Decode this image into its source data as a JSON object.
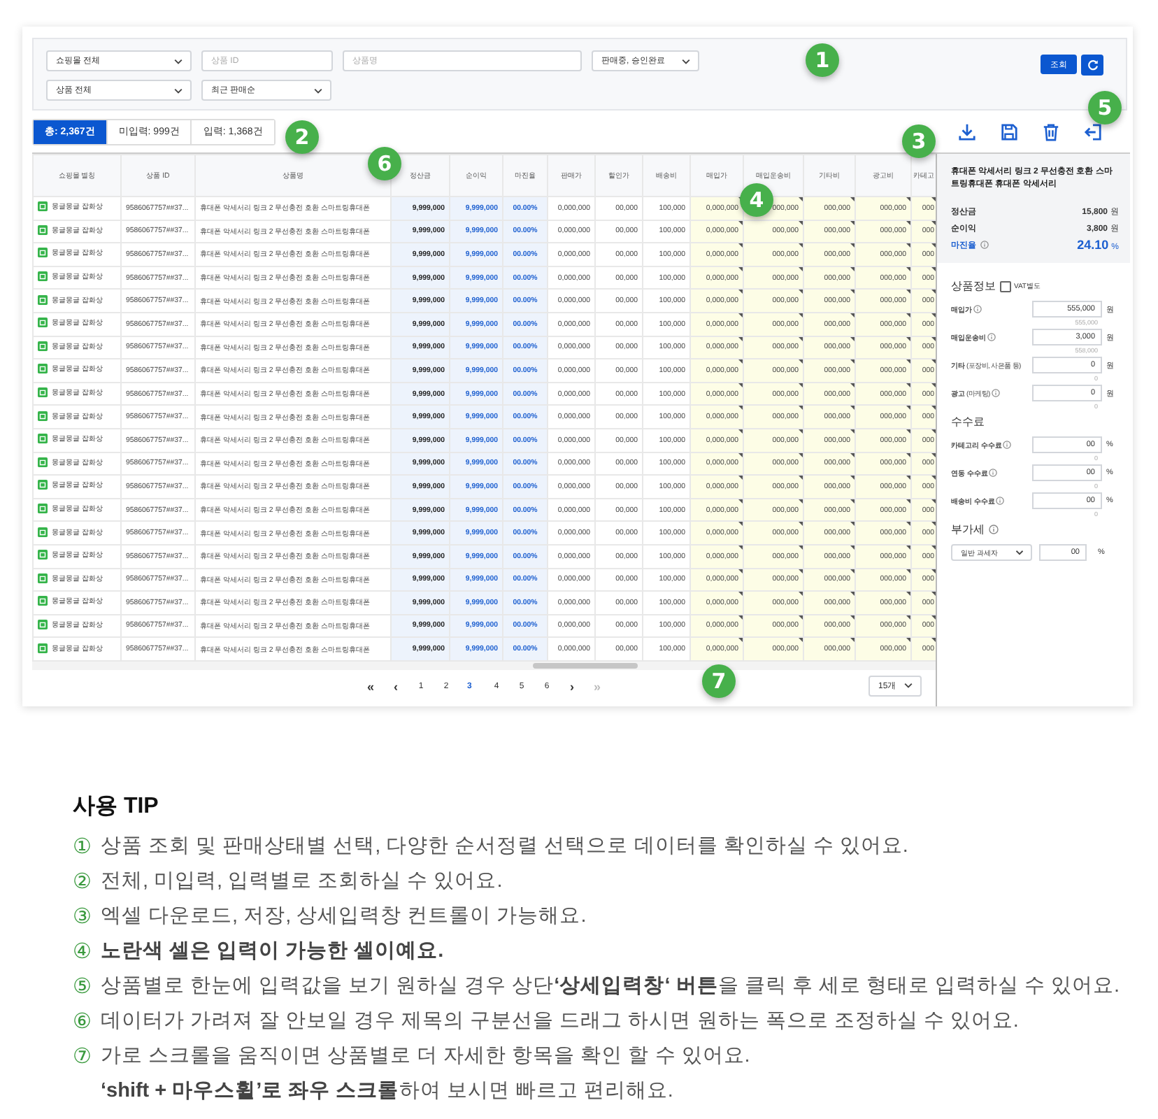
{
  "filters": {
    "row1": [
      {
        "kind": "select",
        "value": "쇼핑몰 전체"
      },
      {
        "kind": "input",
        "placeholder": "상품 ID"
      },
      {
        "kind": "input",
        "placeholder": "상품명"
      },
      {
        "kind": "select",
        "value": "판매중, 승인완료"
      }
    ],
    "row2": [
      {
        "kind": "select",
        "value": "상품 전체"
      },
      {
        "kind": "select",
        "value": "최근 판매순"
      }
    ],
    "search_button": "조회"
  },
  "tabs": [
    {
      "label": "총: 2,367건",
      "selected": true
    },
    {
      "label": "미입력: 999건",
      "selected": false
    },
    {
      "label": "입력: 1,368건",
      "selected": false
    }
  ],
  "table": {
    "columns": [
      {
        "label": "쇼핑몰 별칭",
        "kind": "store"
      },
      {
        "label": "상품 ID",
        "kind": "id"
      },
      {
        "label": "상품명",
        "kind": "name"
      },
      {
        "label": "정산금",
        "kind": "settle"
      },
      {
        "label": "순이익",
        "kind": "profit"
      },
      {
        "label": "마진율",
        "kind": "margin"
      },
      {
        "label": "판매가",
        "kind": "plain"
      },
      {
        "label": "할인가",
        "kind": "plain"
      },
      {
        "label": "배송비",
        "kind": "plain"
      },
      {
        "label": "매입가",
        "kind": "input"
      },
      {
        "label": "매입운송비",
        "kind": "input"
      },
      {
        "label": "기타비",
        "kind": "input"
      },
      {
        "label": "광고비",
        "kind": "input"
      },
      {
        "label": "카테고",
        "kind": "input"
      }
    ],
    "rows": [
      [
        "몽글몽글 잡화상",
        "9586067757##37...",
        "휴대폰 악세서리 링크 2 무선충전 호환 스마트링휴대폰",
        "9,999,000",
        "9,999,000",
        "00.00%",
        "0,000,000",
        "00,000",
        "100,000",
        "0,000,000",
        "000,000",
        "000,000",
        "000,000",
        "000"
      ],
      [
        "몽글몽글 잡화상",
        "9586067757##37...",
        "휴대폰 악세서리 링크 2 무선충전 호환 스마트링휴대폰",
        "9,999,000",
        "9,999,000",
        "00.00%",
        "0,000,000",
        "00,000",
        "100,000",
        "0,000,000",
        "000,000",
        "000,000",
        "000,000",
        "000"
      ],
      [
        "몽글몽글 잡화상",
        "9586067757##37...",
        "휴대폰 악세서리 링크 2 무선충전 호환 스마트링휴대폰",
        "9,999,000",
        "9,999,000",
        "00.00%",
        "0,000,000",
        "00,000",
        "100,000",
        "0,000,000",
        "000,000",
        "000,000",
        "000,000",
        "000"
      ],
      [
        "몽글몽글 잡화상",
        "9586067757##37...",
        "휴대폰 악세서리 링크 2 무선충전 호환 스마트링휴대폰",
        "9,999,000",
        "9,999,000",
        "00.00%",
        "0,000,000",
        "00,000",
        "100,000",
        "0,000,000",
        "000,000",
        "000,000",
        "000,000",
        "000"
      ],
      [
        "몽글몽글 잡화상",
        "9586067757##37...",
        "휴대폰 악세서리 링크 2 무선충전 호환 스마트링휴대폰",
        "9,999,000",
        "9,999,000",
        "00.00%",
        "0,000,000",
        "00,000",
        "100,000",
        "0,000,000",
        "000,000",
        "000,000",
        "000,000",
        "000"
      ],
      [
        "몽글몽글 잡화상",
        "9586067757##37...",
        "휴대폰 악세서리 링크 2 무선충전 호환 스마트링휴대폰",
        "9,999,000",
        "9,999,000",
        "00.00%",
        "0,000,000",
        "00,000",
        "100,000",
        "0,000,000",
        "000,000",
        "000,000",
        "000,000",
        "000"
      ],
      [
        "몽글몽글 잡화상",
        "9586067757##37...",
        "휴대폰 악세서리 링크 2 무선충전 호환 스마트링휴대폰",
        "9,999,000",
        "9,999,000",
        "00.00%",
        "0,000,000",
        "00,000",
        "100,000",
        "0,000,000",
        "000,000",
        "000,000",
        "000,000",
        "000"
      ],
      [
        "몽글몽글 잡화상",
        "9586067757##37...",
        "휴대폰 악세서리 링크 2 무선충전 호환 스마트링휴대폰",
        "9,999,000",
        "9,999,000",
        "00.00%",
        "0,000,000",
        "00,000",
        "100,000",
        "0,000,000",
        "000,000",
        "000,000",
        "000,000",
        "000"
      ],
      [
        "몽글몽글 잡화상",
        "9586067757##37...",
        "휴대폰 악세서리 링크 2 무선충전 호환 스마트링휴대폰",
        "9,999,000",
        "9,999,000",
        "00.00%",
        "0,000,000",
        "00,000",
        "100,000",
        "0,000,000",
        "000,000",
        "000,000",
        "000,000",
        "000"
      ],
      [
        "몽글몽글 잡화상",
        "9586067757##37...",
        "휴대폰 악세서리 링크 2 무선충전 호환 스마트링휴대폰",
        "9,999,000",
        "9,999,000",
        "00.00%",
        "0,000,000",
        "00,000",
        "100,000",
        "0,000,000",
        "000,000",
        "000,000",
        "000,000",
        "000"
      ],
      [
        "몽글몽글 잡화상",
        "9586067757##37...",
        "휴대폰 악세서리 링크 2 무선충전 호환 스마트링휴대폰",
        "9,999,000",
        "9,999,000",
        "00.00%",
        "0,000,000",
        "00,000",
        "100,000",
        "0,000,000",
        "000,000",
        "000,000",
        "000,000",
        "000"
      ],
      [
        "몽글몽글 잡화상",
        "9586067757##37...",
        "휴대폰 악세서리 링크 2 무선충전 호환 스마트링휴대폰",
        "9,999,000",
        "9,999,000",
        "00.00%",
        "0,000,000",
        "00,000",
        "100,000",
        "0,000,000",
        "000,000",
        "000,000",
        "000,000",
        "000"
      ],
      [
        "몽글몽글 잡화상",
        "9586067757##37...",
        "휴대폰 악세서리 링크 2 무선충전 호환 스마트링휴대폰",
        "9,999,000",
        "9,999,000",
        "00.00%",
        "0,000,000",
        "00,000",
        "100,000",
        "0,000,000",
        "000,000",
        "000,000",
        "000,000",
        "000"
      ],
      [
        "몽글몽글 잡화상",
        "9586067757##37...",
        "휴대폰 악세서리 링크 2 무선충전 호환 스마트링휴대폰",
        "9,999,000",
        "9,999,000",
        "00.00%",
        "0,000,000",
        "00,000",
        "100,000",
        "0,000,000",
        "000,000",
        "000,000",
        "000,000",
        "000"
      ],
      [
        "몽글몽글 잡화상",
        "9586067757##37...",
        "휴대폰 악세서리 링크 2 무선충전 호환 스마트링휴대폰",
        "9,999,000",
        "9,999,000",
        "00.00%",
        "0,000,000",
        "00,000",
        "100,000",
        "0,000,000",
        "000,000",
        "000,000",
        "000,000",
        "000"
      ],
      [
        "몽글몽글 잡화상",
        "9586067757##37...",
        "휴대폰 악세서리 링크 2 무선충전 호환 스마트링휴대폰",
        "9,999,000",
        "9,999,000",
        "00.00%",
        "0,000,000",
        "00,000",
        "100,000",
        "0,000,000",
        "000,000",
        "000,000",
        "000,000",
        "000"
      ],
      [
        "몽글몽글 잡화상",
        "9586067757##37...",
        "휴대폰 악세서리 링크 2 무선충전 호환 스마트링휴대폰",
        "9,999,000",
        "9,999,000",
        "00.00%",
        "0,000,000",
        "00,000",
        "100,000",
        "0,000,000",
        "000,000",
        "000,000",
        "000,000",
        "000"
      ],
      [
        "몽글몽글 잡화상",
        "9586067757##37...",
        "휴대폰 악세서리 링크 2 무선충전 호환 스마트링휴대폰",
        "9,999,000",
        "9,999,000",
        "00.00%",
        "0,000,000",
        "00,000",
        "100,000",
        "0,000,000",
        "000,000",
        "000,000",
        "000,000",
        "000"
      ],
      [
        "몽글몽글 잡화상",
        "9586067757##37...",
        "휴대폰 악세서리 링크 2 무선충전 호환 스마트링휴대폰",
        "9,999,000",
        "9,999,000",
        "00.00%",
        "0,000,000",
        "00,000",
        "100,000",
        "0,000,000",
        "000,000",
        "000,000",
        "000,000",
        "000"
      ],
      [
        "몽글몽글 잡화상",
        "9586067757##37...",
        "휴대폰 악세서리 링크 2 무선충전 호환 스마트링휴대폰",
        "9,999,000",
        "9,999,000",
        "00.00%",
        "0,000,000",
        "00,000",
        "100,000",
        "0,000,000",
        "000,000",
        "000,000",
        "000,000",
        "000"
      ]
    ]
  },
  "pagination": {
    "nav": [
      {
        "label": "«",
        "disabled": false
      },
      {
        "label": "‹",
        "disabled": false
      },
      {
        "label": "›",
        "disabled": false
      },
      {
        "label": "»",
        "disabled": true
      }
    ],
    "pages": [
      {
        "label": "1",
        "selected": false
      },
      {
        "label": "2",
        "selected": false
      },
      {
        "label": "3",
        "selected": true
      },
      {
        "label": "4",
        "selected": false
      },
      {
        "label": "5",
        "selected": false
      },
      {
        "label": "6",
        "selected": false
      }
    ],
    "page_size": "15개"
  },
  "side_panel": {
    "title": "휴대폰 악세서리 링크 2 무선충전 호환 스마트링휴대폰 휴대폰 악세서리",
    "summary": [
      {
        "label": "정산금",
        "info": false,
        "kind": "plain",
        "value": "15,800",
        "unit": "원"
      },
      {
        "label": "순이익",
        "info": false,
        "kind": "plain",
        "value": "3,800",
        "unit": "원"
      },
      {
        "label": "마진율",
        "info": true,
        "kind": "highlight",
        "value": "24.10",
        "unit": "%"
      }
    ],
    "sections": [
      {
        "heading": "상품정보",
        "info": false,
        "checkbox": {
          "label": "VAT별도",
          "checked": false
        },
        "fields": [
          {
            "kind": "input",
            "label": "매입가",
            "info": true,
            "value": "555,000",
            "unit": "원",
            "sub": "555,000"
          },
          {
            "kind": "input",
            "label": "매입운송비",
            "info": true,
            "value": "3,000",
            "unit": "원",
            "sub": "558,000"
          },
          {
            "kind": "input",
            "label": "기타",
            "note": "(포장비, 사은품 등)",
            "info": false,
            "value": "0",
            "unit": "원",
            "sub": "0"
          },
          {
            "kind": "input",
            "label": "광고",
            "note": "(마케팅)",
            "info": true,
            "value": "0",
            "unit": "원",
            "sub": "0"
          }
        ]
      },
      {
        "heading": "수수료",
        "info": false,
        "fields": [
          {
            "kind": "input",
            "label": "카테고리 수수료",
            "info": true,
            "value": "00",
            "unit": "%",
            "sub": "0"
          },
          {
            "kind": "input",
            "label": "연동 수수료",
            "info": true,
            "value": "00",
            "unit": "%",
            "sub": "0"
          },
          {
            "kind": "input",
            "label": "배송비 수수료",
            "info": true,
            "value": "00",
            "unit": "%",
            "sub": "0"
          }
        ]
      },
      {
        "heading": "부가세",
        "info": true,
        "fields": [
          {
            "kind": "select",
            "select": "일반 과세자",
            "value": "00",
            "unit": "%"
          }
        ]
      }
    ]
  },
  "callouts": [
    "1",
    "2",
    "3",
    "4",
    "5",
    "6",
    "7"
  ],
  "tips": {
    "heading": "사용 TIP",
    "items": [
      {
        "number": "①",
        "text": "상품 조회 및 판매상태별 선택, 다양한 순서정렬 선택으로 데이터를 확인하실 수 있어요."
      },
      {
        "number": "②",
        "text": "전체, 미입력, 입력별로 조회하실 수 있어요."
      },
      {
        "number": "③",
        "text": "엑셀 다운로드, 저장, 상세입력창 컨트롤이 가능해요."
      },
      {
        "number": "④",
        "text": "**노란색 셀은 입력이 가능한 셀이예요.**"
      },
      {
        "number": "⑤",
        "text": "상품별로 한눈에 입력값을 보기 원하실 경우 상단**‘상세입력창‘ 버튼**을 클릭 후 세로 형태로 입력하실 수 있어요."
      },
      {
        "number": "⑥",
        "text": "데이터가 가려져 잘 안보일 경우 제목의 구분선을 드래그 하시면 원하는 폭으로 조정하실 수 있어요."
      },
      {
        "number": "⑦",
        "text": "가로 스크롤을 움직이면 상품별로 더 자세한 항목을 확인 할 수 있어요.",
        "continuation": "**‘shift + 마우스휠’로 좌우 스크롤**하여 보시면 빠르고 편리해요."
      }
    ]
  }
}
